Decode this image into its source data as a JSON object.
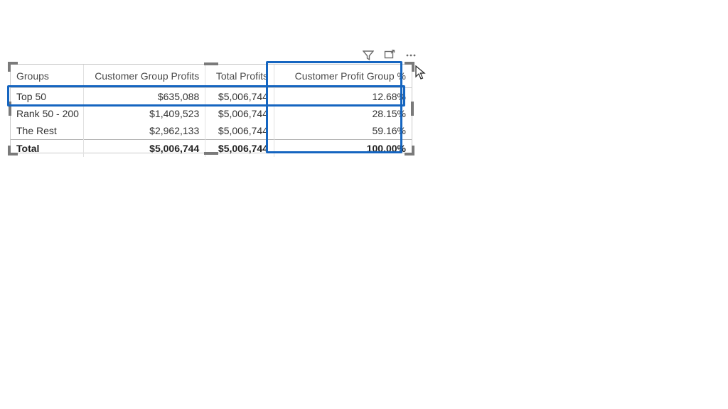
{
  "toolbar": {
    "filter_icon": "filter-icon",
    "focus_icon": "focus-mode-icon",
    "more_icon": "more-options-icon"
  },
  "table": {
    "headers": {
      "groups": "Groups",
      "profits": "Customer Group Profits",
      "total": "Total Profits",
      "pct": "Customer Profit Group %"
    },
    "rows": [
      {
        "group": "Top 50",
        "profits": "$635,088",
        "total": "$5,006,744",
        "pct": "12.68%"
      },
      {
        "group": "Rank 50 - 200",
        "profits": "$1,409,523",
        "total": "$5,006,744",
        "pct": "28.15%"
      },
      {
        "group": "The Rest",
        "profits": "$2,962,133",
        "total": "$5,006,744",
        "pct": "59.16%"
      }
    ],
    "total": {
      "group": "Total",
      "profits": "$5,006,744",
      "total": "$5,006,744",
      "pct": "100.00%"
    }
  },
  "chart_data": {
    "type": "table",
    "title": "Customer Profit Group %",
    "columns": [
      "Groups",
      "Customer Group Profits",
      "Total Profits",
      "Customer Profit Group %"
    ],
    "rows": [
      [
        "Top 50",
        635088,
        5006744,
        12.68
      ],
      [
        "Rank 50 - 200",
        1409523,
        5006744,
        28.15
      ],
      [
        "The Rest",
        2962133,
        5006744,
        59.16
      ]
    ],
    "total_row": [
      "Total",
      5006744,
      5006744,
      100.0
    ]
  }
}
